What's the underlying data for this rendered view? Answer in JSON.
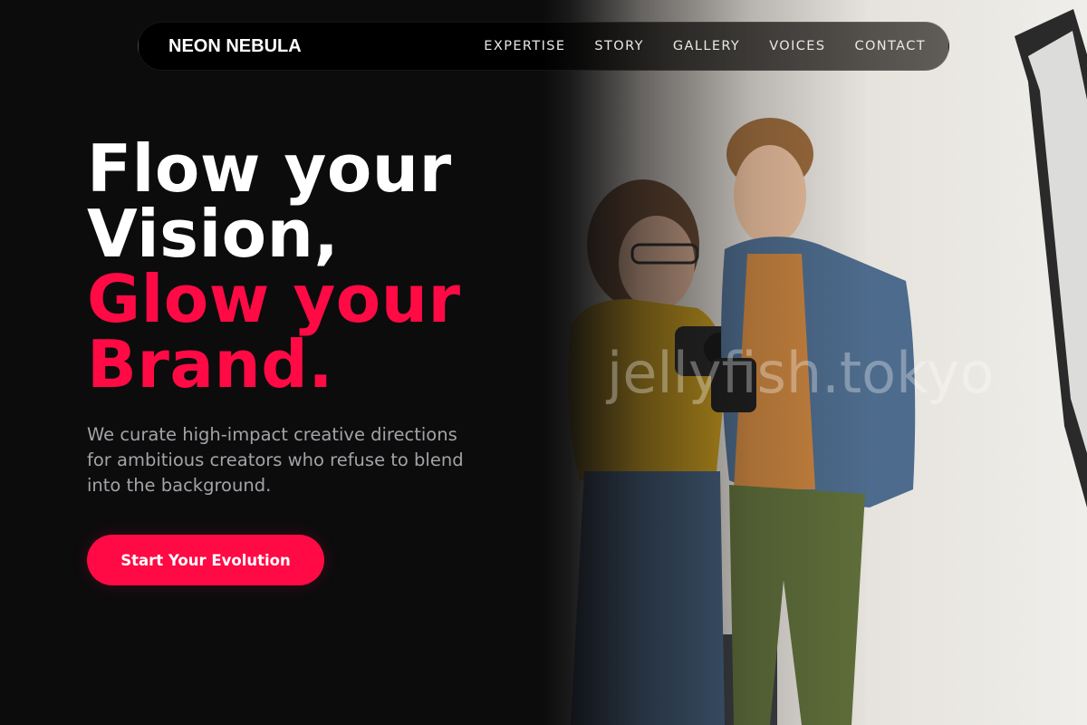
{
  "nav": {
    "brand": "NEON NEBULA",
    "links": [
      "EXPERTISE",
      "STORY",
      "GALLERY",
      "VOICES",
      "CONTACT"
    ]
  },
  "hero": {
    "headline_line1": "Flow your",
    "headline_line2": "Vision,",
    "headline_line3": "Glow your",
    "headline_line4": "Brand.",
    "subcopy": "We curate high-impact creative directions for ambitious creators who refuse to blend into the background.",
    "cta_label": "Start Your Evolution"
  },
  "photo": {
    "watermark": "jellyfish.tokyo"
  },
  "colors": {
    "background": "#0c0c0d",
    "accent": "#ff0a44",
    "headline": "#ffffff",
    "body_text": "#a3a3a8"
  }
}
